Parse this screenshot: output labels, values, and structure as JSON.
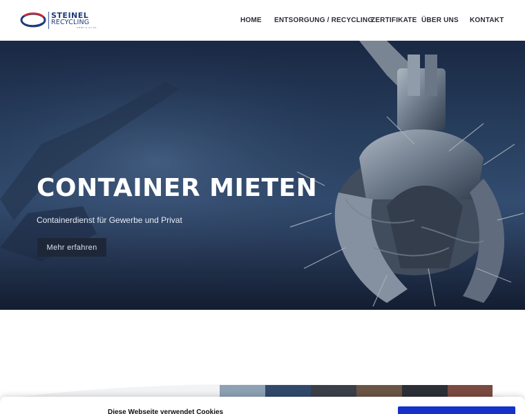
{
  "brand": {
    "name_line1": "STEINEL",
    "name_line2": "RECYCLING",
    "name_line3": "GMBH & CO.KG"
  },
  "nav": {
    "items": [
      {
        "label": "HOME"
      },
      {
        "label": "ENTSORGUNG / RECYCLING"
      },
      {
        "label": "ZERTIFIKATE"
      },
      {
        "label": "ÜBER UNS"
      },
      {
        "label": "KONTAKT"
      }
    ]
  },
  "hero": {
    "title": "CONTAINER MIETEN",
    "subtitle": "Containerdienst für Gewerbe und Privat",
    "button_label": "Mehr erfahren"
  },
  "cookie": {
    "text": "Diese Webseite verwendet Cookies"
  },
  "colors": {
    "brand_blue": "#1e3b7a",
    "hero_dark": "#1c2b48",
    "cta_dark": "#1e2738",
    "cookie_button": "#1432c8"
  }
}
